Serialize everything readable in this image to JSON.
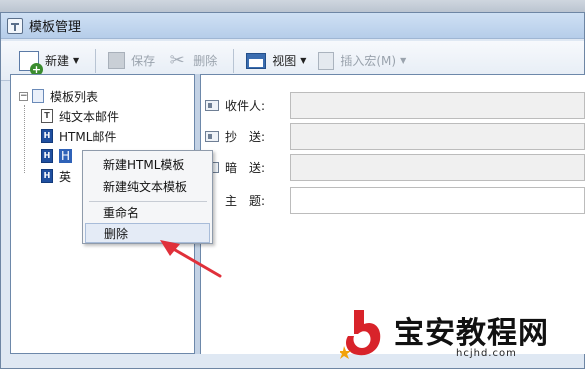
{
  "window": {
    "title": "模板管理"
  },
  "toolbar": {
    "new_label": "新建",
    "save_label": "保存",
    "delete_label": "删除",
    "view_label": "视图",
    "insert_macro_label": "插入宏(M)"
  },
  "tree": {
    "root": "模板列表",
    "items": [
      {
        "label": "纯文本邮件",
        "icon": "text-template-icon"
      },
      {
        "label": "HTML邮件",
        "icon": "html-template-icon"
      },
      {
        "label": "H",
        "icon": "html-template-icon",
        "selected": true
      },
      {
        "label": "英",
        "icon": "html-template-icon"
      }
    ]
  },
  "context_menu": {
    "items": [
      "新建HTML模板",
      "新建纯文本模板",
      "重命名",
      "删除"
    ],
    "highlighted": "删除"
  },
  "form": {
    "to_label": "收件人:",
    "cc_label": "抄　送:",
    "bcc_label": "暗　送:",
    "subject_label": "主　题:"
  },
  "watermark": {
    "brand": "宝安教程网",
    "url": "hcjhd.com"
  },
  "colors": {
    "selection": "#2f62b8",
    "arrow": "#e0303a",
    "frame": "#dfe8f3"
  }
}
